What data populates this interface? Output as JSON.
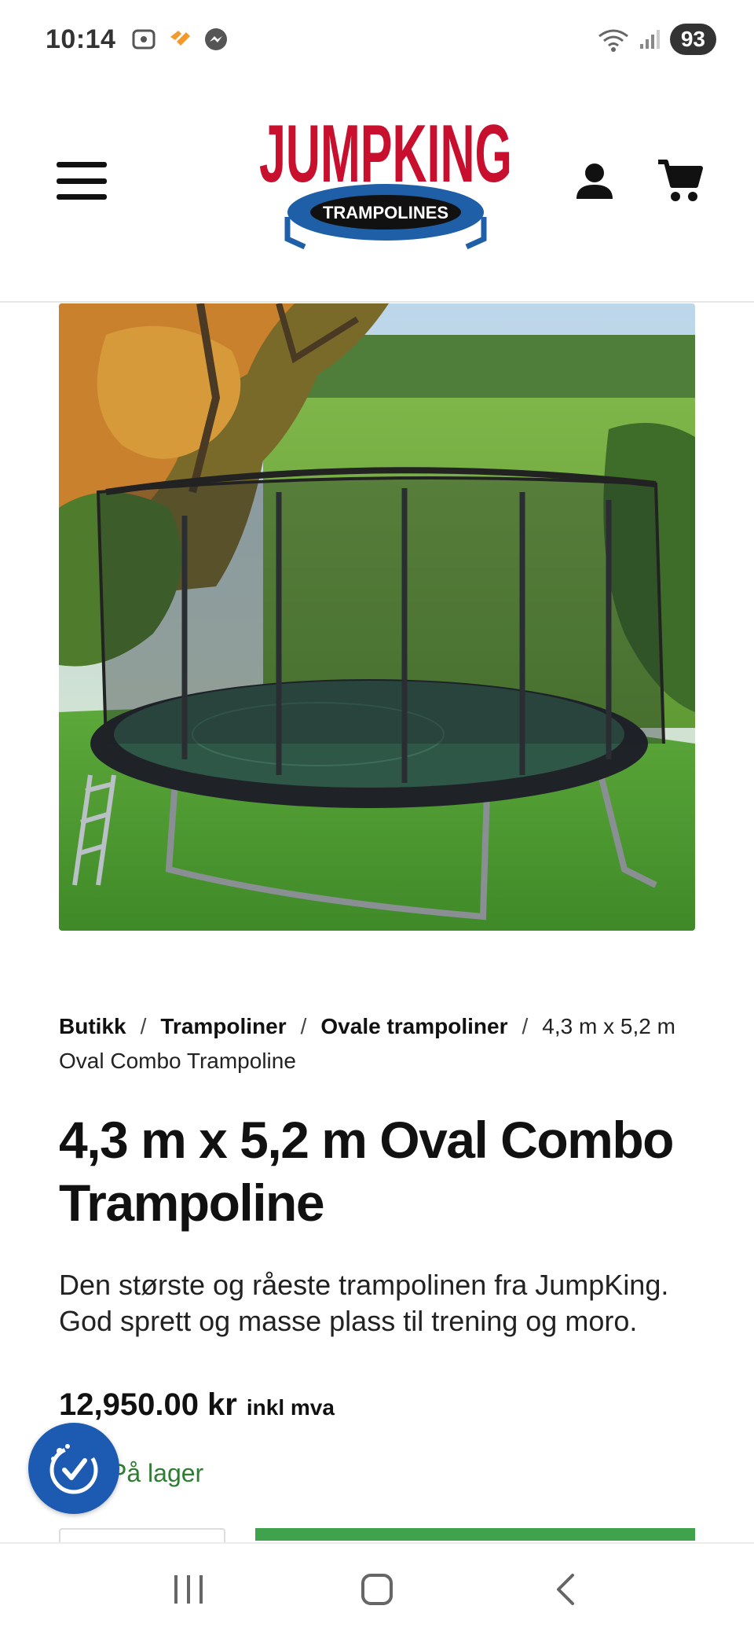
{
  "status_bar": {
    "time": "10:14",
    "battery": "93",
    "icons": [
      "screenshot-icon",
      "app-heart-icon",
      "messenger-icon",
      "wifi-icon",
      "signal-icon"
    ]
  },
  "header": {
    "logo_text": "JUMPKING",
    "logo_subtext": "TRAMPOLINES",
    "menu_icon": "hamburger-icon",
    "account_icon": "user-icon",
    "cart_icon": "cart-icon"
  },
  "colors": {
    "brand_red": "#c8102e",
    "brand_blue": "#1f5fa8",
    "stock_green": "#2f7d32",
    "cta_green": "#3fa34d",
    "a11y_blue": "#1d5bb3"
  },
  "breadcrumb": {
    "items": [
      "Butikk",
      "Trampoliner",
      "Ovale trampoliner"
    ],
    "separator": "/",
    "current": "4,3 m x 5,2 m Oval Combo Trampoline"
  },
  "product": {
    "title": "4,3 m x 5,2 m Oval Combo Trampoline",
    "description": "Den største og råeste trampolinen fra JumpKing. God sprett og masse plass til trening og moro.",
    "price": "12,950.00 kr",
    "price_suffix": "inkl mva",
    "stock": "På lager"
  },
  "nav_bar": {
    "icons": [
      "recent-apps-icon",
      "home-icon",
      "back-icon"
    ]
  }
}
